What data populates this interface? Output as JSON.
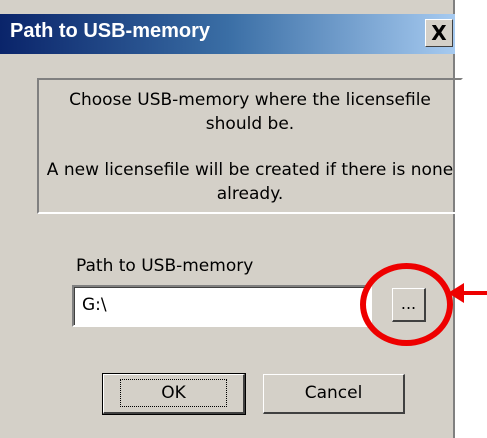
{
  "window": {
    "title": "Path to USB-memory",
    "close_symbol": "X"
  },
  "info": {
    "line1": "Choose USB-memory where the licensefile should be.",
    "line2": "A new licensefile will be created if there is none already."
  },
  "path": {
    "label": "Path to USB-memory",
    "value": "G:\\",
    "browse_label": "..."
  },
  "buttons": {
    "ok": "OK",
    "cancel": "Cancel"
  },
  "annotation": {
    "highlight_color": "#ee0000"
  }
}
